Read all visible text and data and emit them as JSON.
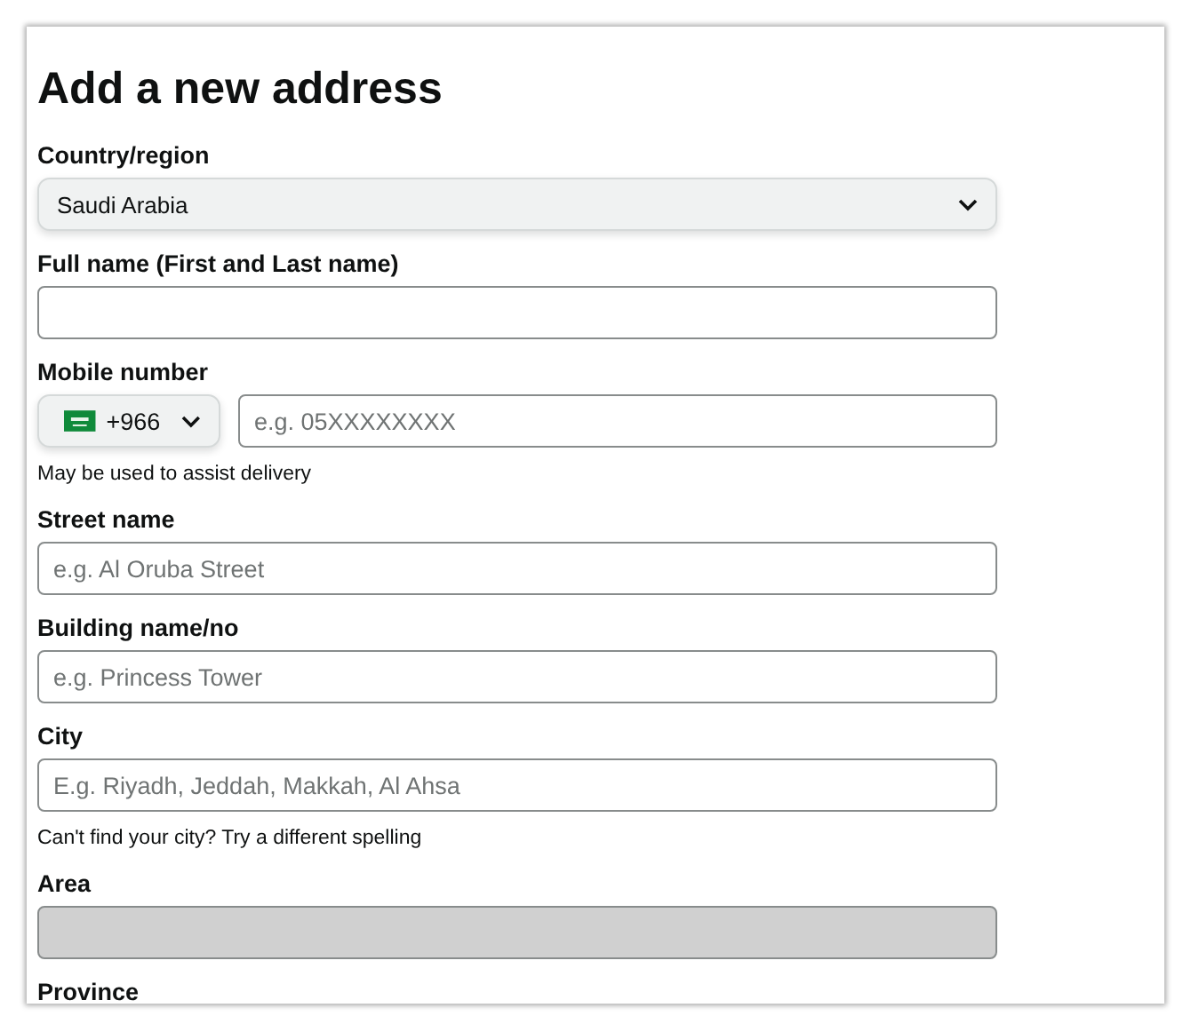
{
  "title": "Add a new address",
  "fields": [
    {
      "kind": "select",
      "label": "Country/region",
      "value": "Saudi Arabia"
    },
    {
      "kind": "text",
      "label": "Full name (First and Last name)",
      "disabled": false
    },
    {
      "kind": "phone",
      "label": "Mobile number",
      "code": "+966",
      "placeholder": "e.g. 05XXXXXXXX",
      "hint": "May be used to assist delivery"
    },
    {
      "kind": "text",
      "label": "Street name",
      "placeholder": "e.g. Al Oruba Street",
      "disabled": false
    },
    {
      "kind": "text",
      "label": "Building name/no",
      "placeholder": "e.g. Princess Tower",
      "disabled": false
    },
    {
      "kind": "text",
      "label": "City",
      "placeholder": "E.g. Riyadh, Jeddah, Makkah, Al Ahsa",
      "hint": "Can't find your city? Try a different spelling",
      "disabled": false
    },
    {
      "kind": "text",
      "label": "Area",
      "disabled": true
    },
    {
      "kind": "label",
      "label": "Province"
    }
  ]
}
